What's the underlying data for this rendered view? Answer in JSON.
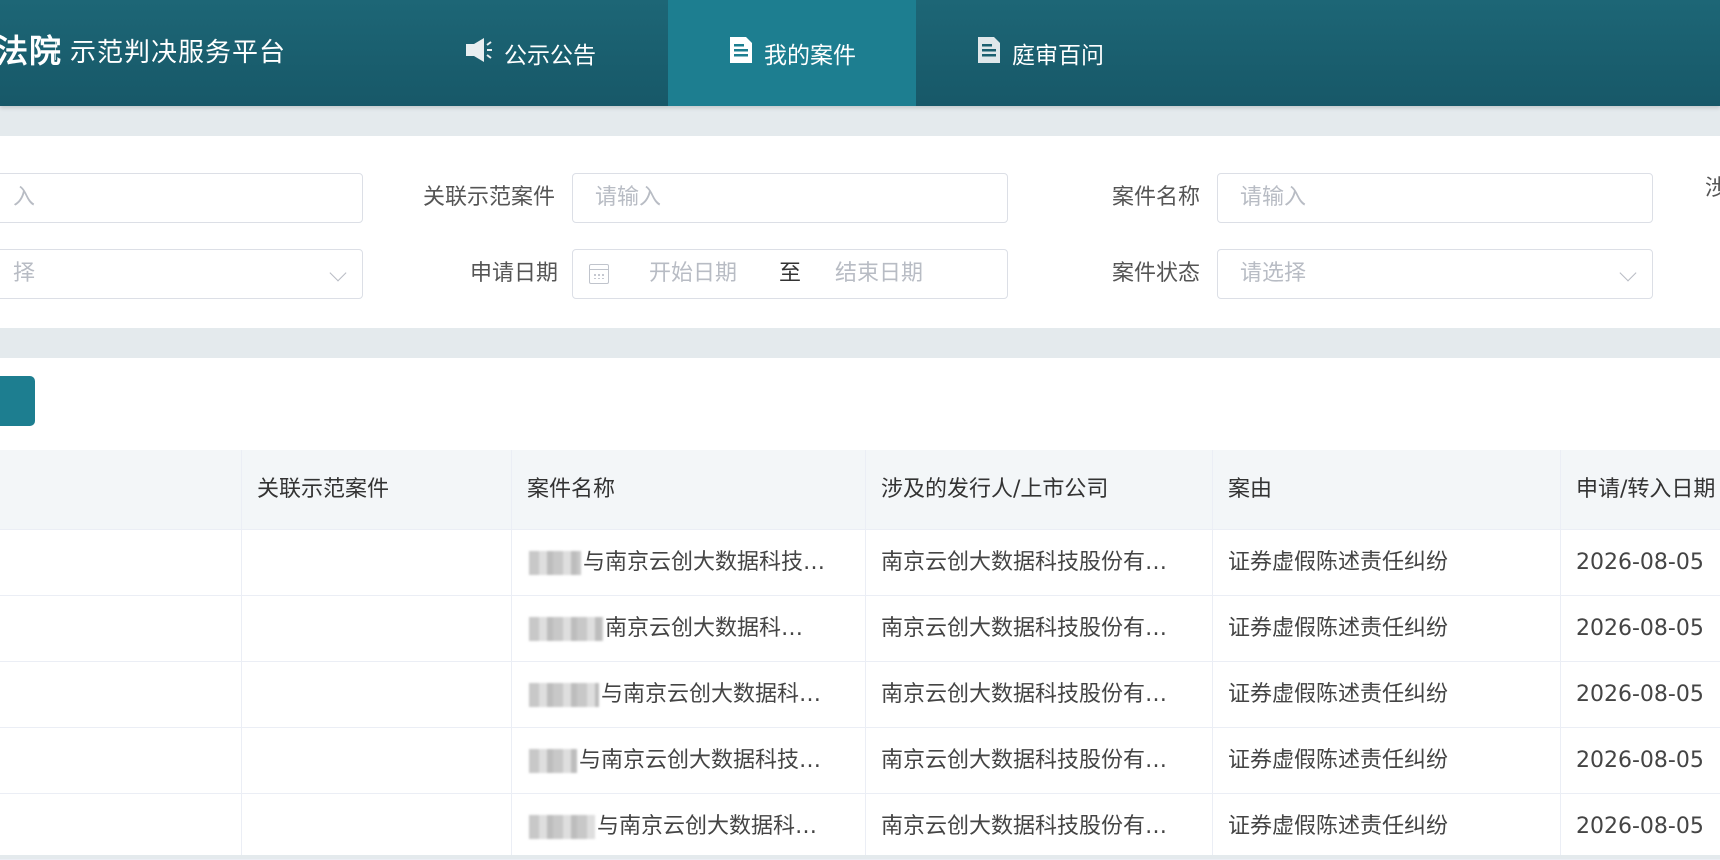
{
  "header": {
    "logo_text": "法院",
    "platform_title": "示范判决服务平台",
    "nav": [
      {
        "label": "公示公告",
        "icon": "speaker-icon",
        "active": false
      },
      {
        "label": "我的案件",
        "icon": "document-icon",
        "active": true
      },
      {
        "label": "庭审百问",
        "icon": "document-icon",
        "active": false
      }
    ]
  },
  "filters": {
    "row1": {
      "first_placeholder": "入",
      "related_case_label": "关联示范案件",
      "related_case_placeholder": "请输入",
      "case_name_label": "案件名称",
      "case_name_placeholder": "请输入",
      "cut_label": "涉"
    },
    "row2": {
      "first_select_placeholder": "择",
      "apply_date_label": "申请日期",
      "start_date_placeholder": "开始日期",
      "date_separator": "至",
      "end_date_placeholder": "结束日期",
      "case_status_label": "案件状态",
      "case_status_placeholder": "请选择"
    }
  },
  "table": {
    "headers": [
      "关联示范案件",
      "案件名称",
      "涉及的发行人/上市公司",
      "案由",
      "申请/转入日期"
    ],
    "rows": [
      {
        "related": "",
        "case_name": "与南京云创大数据科技…",
        "company": "南京云创大数据科技股份有…",
        "cause": "证券虚假陈述责任纠纷",
        "date": "2026-08-05"
      },
      {
        "related": "",
        "case_name": "南京云创大数据科…",
        "company": "南京云创大数据科技股份有…",
        "cause": "证券虚假陈述责任纠纷",
        "date": "2026-08-05"
      },
      {
        "related": "",
        "case_name": "与南京云创大数据科…",
        "company": "南京云创大数据科技股份有…",
        "cause": "证券虚假陈述责任纠纷",
        "date": "2026-08-05"
      },
      {
        "related": "",
        "case_name": "与南京云创大数据科技…",
        "company": "南京云创大数据科技股份有…",
        "cause": "证券虚假陈述责任纠纷",
        "date": "2026-08-05"
      },
      {
        "related": "",
        "case_name": "与南京云创大数据科…",
        "company": "南京云创大数据科技股份有…",
        "cause": "证券虚假陈述责任纠纷",
        "date": "2026-08-05"
      }
    ]
  },
  "colors": {
    "header_bg": "#1a5f6f",
    "nav_active_bg": "#1d7e90",
    "page_bg": "#e4eaed",
    "table_header_bg": "#f3f6f8"
  }
}
